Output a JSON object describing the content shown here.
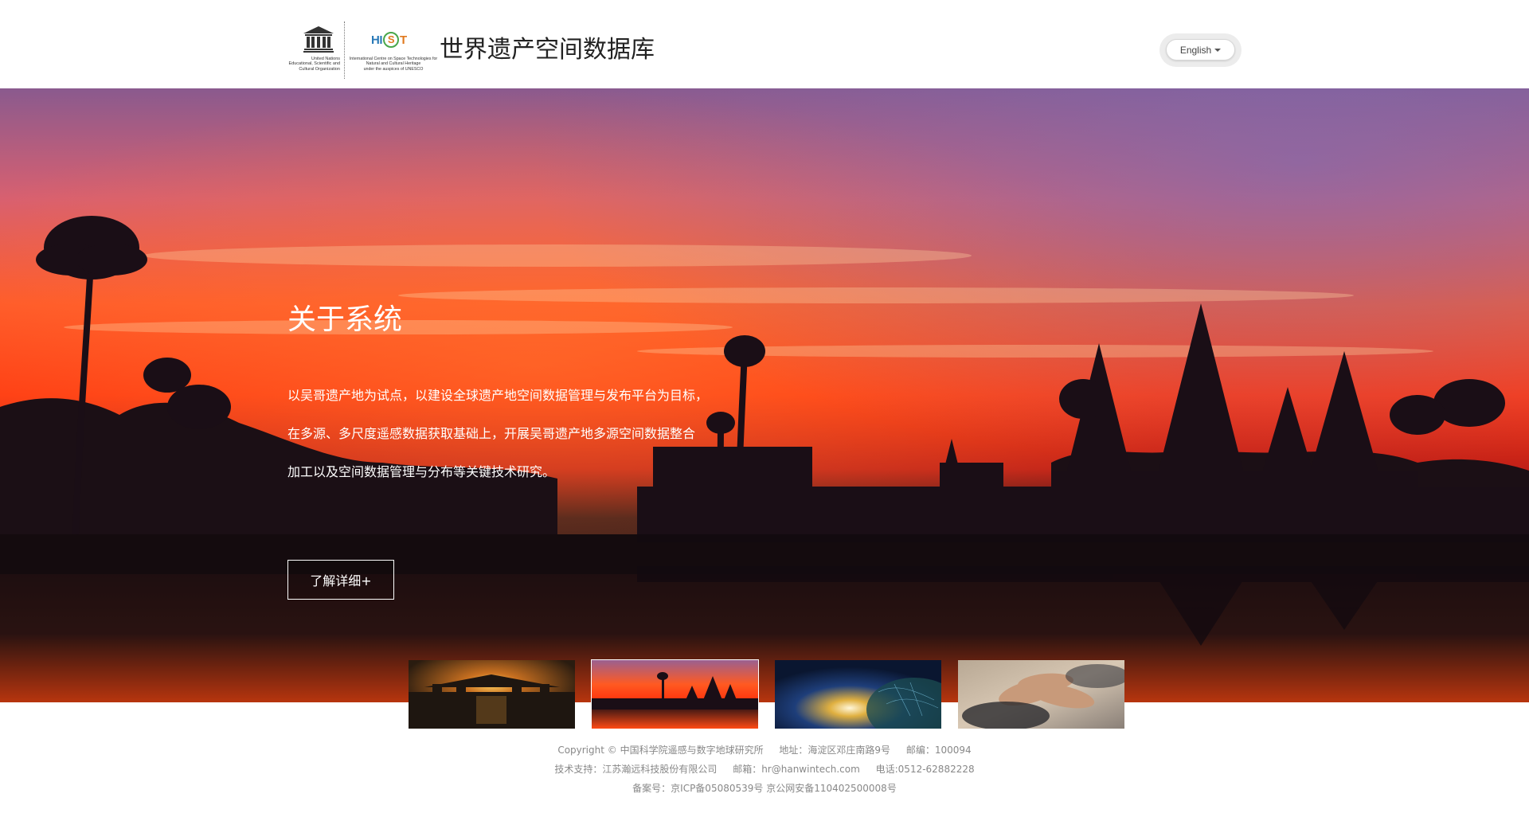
{
  "header": {
    "unesco_text": "United Nations\nEducational, Scientific and\nCultural Organization",
    "hist_text": "International Centre on Space Technologies for\nNatural and Cultural Heritage\nunder the auspices of UNESCO",
    "site_title": "世界遗产空间数据库",
    "language_label": "English"
  },
  "hero": {
    "title": "关于系统",
    "paragraphs": [
      "以吴哥遗产地为试点，以建设全球遗产地空间数据管理与发布平台为目标，",
      "在多源、多尺度遥感数据获取基础上，开展吴哥遗产地多源空间数据整合",
      "加工以及空间数据管理与分布等关键技术研究。"
    ],
    "more_label": "了解详细+"
  },
  "thumbnails": [
    {
      "name": "temple-sunset",
      "active": false
    },
    {
      "name": "angkor-silhouette",
      "active": true
    },
    {
      "name": "globe-network",
      "active": false
    },
    {
      "name": "hands-together",
      "active": false
    }
  ],
  "footer": {
    "row1": [
      "Copyright © 中国科学院遥感与数字地球研究所",
      "地址：海淀区邓庄南路9号",
      "邮编：100094"
    ],
    "row2": [
      "技术支持：江苏瀚远科技股份有限公司",
      "邮箱：hr@hanwintech.com",
      "电话:0512-62882228"
    ],
    "row3": [
      "备案号：京ICP备05080539号 京公网安备110402500008号"
    ]
  },
  "colors": {
    "sky_top": "#7a5a9a",
    "sky_mid": "#ff4a1a",
    "silhouette": "#1a0e16",
    "footer_text": "#888888"
  }
}
